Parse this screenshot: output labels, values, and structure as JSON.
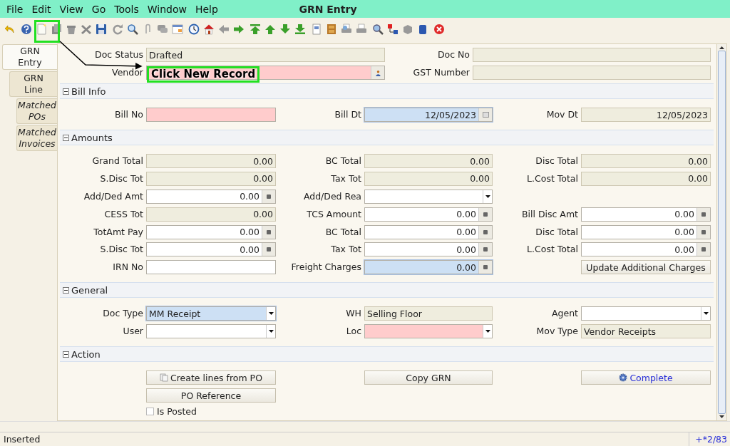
{
  "window": {
    "title": "GRN Entry"
  },
  "menu": [
    {
      "label": "File"
    },
    {
      "label": "Edit"
    },
    {
      "label": "View"
    },
    {
      "label": "Go"
    },
    {
      "label": "Tools"
    },
    {
      "label": "Window"
    },
    {
      "label": "Help"
    }
  ],
  "callout": {
    "text": "Click New Record"
  },
  "tabs": [
    {
      "label": "GRN Entry",
      "included": false,
      "selected": true,
      "children": [
        {
          "label": "GRN Line",
          "included": false,
          "selected": false,
          "children": [
            {
              "label": "Matched POs",
              "included": true,
              "selected": false
            },
            {
              "label": "Matched Invoices",
              "included": true,
              "selected": false
            }
          ]
        }
      ]
    }
  ],
  "header": {
    "rows": [
      [
        {
          "label": "Doc Status",
          "value": "Drafted",
          "read_only": true,
          "mandatory": false,
          "focused": false,
          "kind": "text"
        },
        {
          "label": "Doc No",
          "read_only": true,
          "mandatory": false,
          "focused": false,
          "kind": "text"
        }
      ],
      [
        {
          "label": "Vendor",
          "read_only": false,
          "mandatory": true,
          "focused": false,
          "kind": "lookup"
        },
        {
          "label": "GST Number",
          "read_only": true,
          "mandatory": false,
          "focused": false,
          "kind": "text"
        }
      ]
    ]
  },
  "sections": [
    {
      "title": "Bill Info",
      "expanded": true,
      "rows": [
        [
          {
            "label": "Bill No",
            "read_only": false,
            "mandatory": true,
            "focused": false,
            "kind": "text"
          },
          {
            "label": "Bill Dt",
            "value": "12/05/2023",
            "read_only": false,
            "mandatory": false,
            "focused": true,
            "kind": "date"
          },
          {
            "label": "Mov Dt",
            "value": "12/05/2023",
            "read_only": true,
            "mandatory": false,
            "focused": false,
            "kind": "date"
          }
        ]
      ]
    },
    {
      "title": "Amounts",
      "expanded": true,
      "rows": [
        [
          {
            "label": "Grand Total",
            "value": "0.00",
            "read_only": true,
            "mandatory": false,
            "focused": false,
            "kind": "number"
          },
          {
            "label": "BC Total",
            "value": "0.00",
            "read_only": true,
            "mandatory": false,
            "focused": false,
            "kind": "number"
          },
          {
            "label": "Disc Total",
            "value": "0.00",
            "read_only": true,
            "mandatory": false,
            "focused": false,
            "kind": "number"
          }
        ],
        [
          {
            "label": "S.Disc Tot",
            "value": "0.00",
            "read_only": true,
            "mandatory": false,
            "focused": false,
            "kind": "number"
          },
          {
            "label": "Tax Tot",
            "value": "0.00",
            "read_only": true,
            "mandatory": false,
            "focused": false,
            "kind": "number"
          },
          {
            "label": "L.Cost Total",
            "value": "0.00",
            "read_only": true,
            "mandatory": false,
            "focused": false,
            "kind": "number"
          }
        ],
        [
          {
            "label": "Add/Ded Amt",
            "value": "0.00",
            "read_only": false,
            "mandatory": false,
            "focused": false,
            "kind": "number"
          },
          {
            "label": "Add/Ded Rea",
            "read_only": false,
            "mandatory": false,
            "focused": false,
            "kind": "combo"
          },
          null
        ],
        [
          {
            "label": "CESS Tot",
            "value": "0.00",
            "read_only": true,
            "mandatory": false,
            "focused": false,
            "kind": "number"
          },
          {
            "label": "TCS Amount",
            "value": "0.00",
            "read_only": false,
            "mandatory": false,
            "focused": false,
            "kind": "number"
          },
          {
            "label": "Bill Disc Amt",
            "value": "0.00",
            "read_only": false,
            "mandatory": false,
            "focused": false,
            "kind": "number"
          }
        ],
        [
          {
            "label": "TotAmt Pay",
            "value": "0.00",
            "read_only": false,
            "mandatory": false,
            "focused": false,
            "kind": "number"
          },
          {
            "label": "BC Total",
            "value": "0.00",
            "read_only": false,
            "mandatory": false,
            "focused": false,
            "kind": "number"
          },
          {
            "label": "Disc Total",
            "value": "0.00",
            "read_only": false,
            "mandatory": false,
            "focused": false,
            "kind": "number"
          }
        ],
        [
          {
            "label": "S.Disc Tot",
            "value": "0.00",
            "read_only": false,
            "mandatory": false,
            "focused": false,
            "kind": "number"
          },
          {
            "label": "Tax Tot",
            "value": "0.00",
            "read_only": false,
            "mandatory": false,
            "focused": false,
            "kind": "number"
          },
          {
            "label": "L.Cost Total",
            "value": "0.00",
            "read_only": false,
            "mandatory": false,
            "focused": false,
            "kind": "number"
          }
        ],
        [
          {
            "label": "IRN No",
            "read_only": false,
            "mandatory": false,
            "focused": false,
            "kind": "text"
          },
          {
            "label": "Freight Charges",
            "value": "0.00",
            "read_only": false,
            "mandatory": false,
            "focused": true,
            "kind": "number"
          },
          {
            "kind": "button",
            "text": "Update Additional Charges"
          }
        ]
      ]
    },
    {
      "title": "General",
      "expanded": true,
      "rows": [
        [
          {
            "label": "Doc Type",
            "value": "MM Receipt",
            "read_only": false,
            "mandatory": false,
            "focused": true,
            "kind": "combo"
          },
          {
            "label": "WH",
            "value": "Selling Floor",
            "read_only": true,
            "mandatory": false,
            "focused": false,
            "kind": "text"
          },
          {
            "label": "Agent",
            "read_only": false,
            "mandatory": false,
            "focused": false,
            "kind": "combo"
          }
        ],
        [
          {
            "label": "User",
            "read_only": false,
            "mandatory": false,
            "focused": false,
            "kind": "combo"
          },
          {
            "label": "Loc",
            "read_only": false,
            "mandatory": true,
            "focused": false,
            "kind": "combo"
          },
          {
            "label": "Mov Type",
            "value": "Vendor Receipts",
            "read_only": true,
            "mandatory": false,
            "focused": false,
            "kind": "text"
          }
        ]
      ]
    },
    {
      "title": "Action",
      "expanded": true,
      "rows": [
        [
          {
            "kind": "document_button",
            "text": "Create lines from PO"
          },
          {
            "kind": "button",
            "text": "Copy GRN"
          },
          {
            "kind": "process_button",
            "text": "Complete"
          }
        ],
        [
          {
            "kind": "button",
            "text": "PO Reference"
          },
          null,
          null
        ],
        [
          {
            "kind": "checkbox",
            "text": "Is Posted",
            "checked": false
          },
          null,
          null
        ]
      ]
    }
  ],
  "status_bar": {
    "message": "Inserted",
    "record": "+*2/83"
  }
}
